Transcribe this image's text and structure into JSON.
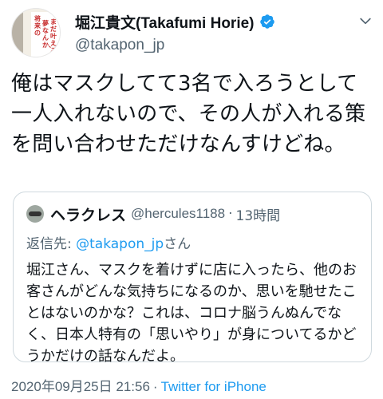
{
  "author": {
    "display_name": "堀江貴文(Takafumi Horie)",
    "handle": "@takapon_jp",
    "verified": true,
    "avatar_text": [
      "将来の",
      "夢なんか、",
      "まだ叶えろ"
    ]
  },
  "tweet": {
    "text": "俺はマスクしてて3名で入ろうとして一人入れないので、その人が入れる策を問い合わせただけなんすけどね。",
    "timestamp": "2020年09月25日 21:56",
    "separator": "·",
    "source": "Twitter for iPhone"
  },
  "quoted_tweet": {
    "display_name": "ヘラクレス",
    "handle": "@hercules1188",
    "separator": "·",
    "time": "13時間",
    "reply_prefix": "返信先: ",
    "reply_to": "@takapon_jp",
    "reply_suffix": "さん",
    "text": "堀江さん、マスクを着けずに店に入ったら、他のお客さんがどんな気持ちになるのか、思いを馳せたことはないのかな？これは、コロナ脳うんぬんでなく、日本人特有の「思いやり」が身についてるかどうかだけの話なんだよ。"
  },
  "colors": {
    "text": "#0f1419",
    "secondary": "#536471",
    "accent": "#1d9bf0",
    "border": "#cfd9de"
  },
  "icons": {
    "verified": "verified-badge-icon",
    "menu": "chevron-down-icon"
  }
}
